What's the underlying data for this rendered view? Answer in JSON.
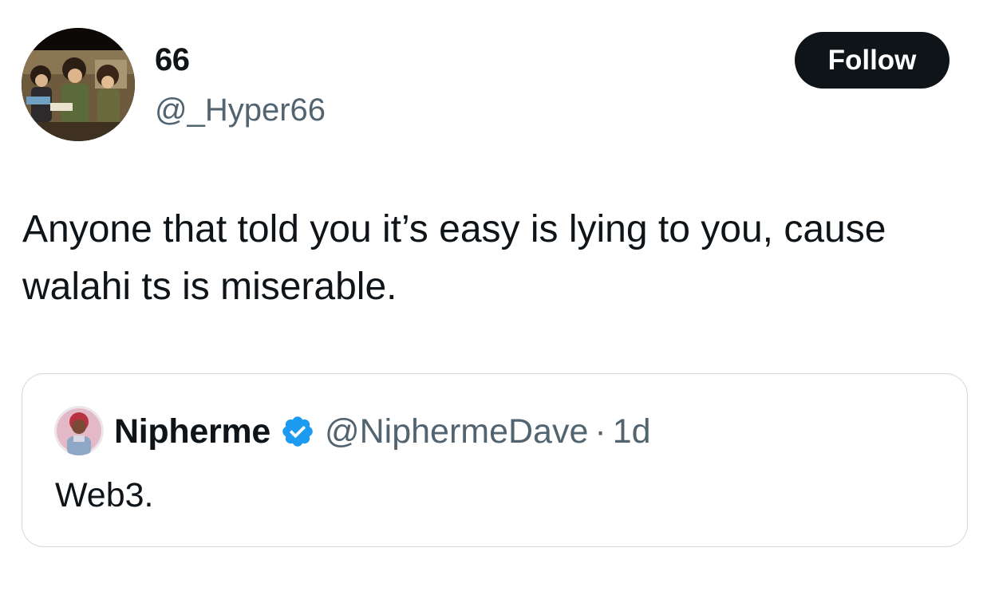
{
  "author": {
    "display_name": "66",
    "handle": "@_Hyper66"
  },
  "follow_button": {
    "label": "Follow"
  },
  "tweet": {
    "text": "Anyone that told you it’s easy is lying to you, cause walahi ts is miserable."
  },
  "quoted_tweet": {
    "display_name": "Nipherme",
    "verified_icon": "verified-badge-icon",
    "handle": "@NiphermeDave",
    "separator": "·",
    "time": "1d",
    "text": "Web3."
  },
  "colors": {
    "text_primary": "#0f1419",
    "text_secondary": "#536471",
    "button_bg": "#0f1419",
    "verified_blue": "#1d9bf0",
    "card_border": "#cfd9de"
  }
}
